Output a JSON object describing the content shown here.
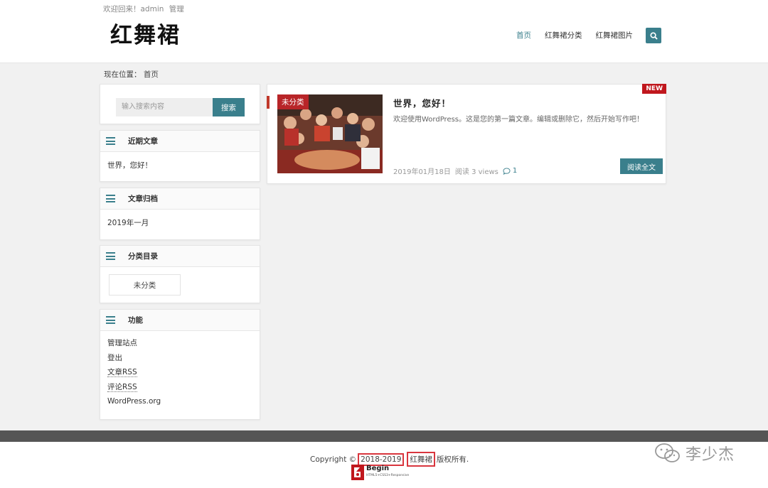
{
  "header": {
    "welcome": "欢迎回来！admin",
    "manage": "管理",
    "logo": "红舞裙",
    "nav": [
      "首页",
      "红舞裙分类",
      "红舞裙图片"
    ]
  },
  "breadcrumb": "现在位置： 首页",
  "sidebar": {
    "search": {
      "placeholder": "输入搜索内容",
      "button": "搜索"
    },
    "recent": {
      "title": "近期文章",
      "items": [
        "世界，您好！"
      ]
    },
    "archive": {
      "title": "文章归档",
      "items": [
        "2019年一月"
      ]
    },
    "categories": {
      "title": "分类目录",
      "items": [
        "未分类"
      ]
    },
    "meta": {
      "title": "功能",
      "items": [
        "管理站点",
        "登出",
        "文章RSS",
        "评论RSS",
        "WordPress.org"
      ]
    }
  },
  "post": {
    "category": "未分类",
    "badge": "NEW",
    "title": "世界，您好！",
    "excerpt": "欢迎使用WordPress。这是您的第一篇文章。编辑或删除它，然后开始写作吧！",
    "date": "2019年01月18日",
    "views": "阅读 3 views",
    "comments": "1",
    "read_more": "阅读全文"
  },
  "footer": {
    "copyright_prefix": "Copyright ©",
    "years": "2018-2019",
    "site": "红舞裙",
    "suffix": "版权所有.",
    "begin_logo": "Begin",
    "begin_sub": "HTML5+CSS3+Responsive"
  },
  "watermark": "李少杰",
  "colors": {
    "accent": "#3a7f8c",
    "red": "#c0171d",
    "footer_bar": "#555555"
  },
  "icons": {
    "search": "search-icon",
    "menu": "menu-icon",
    "comment": "comment-icon"
  }
}
